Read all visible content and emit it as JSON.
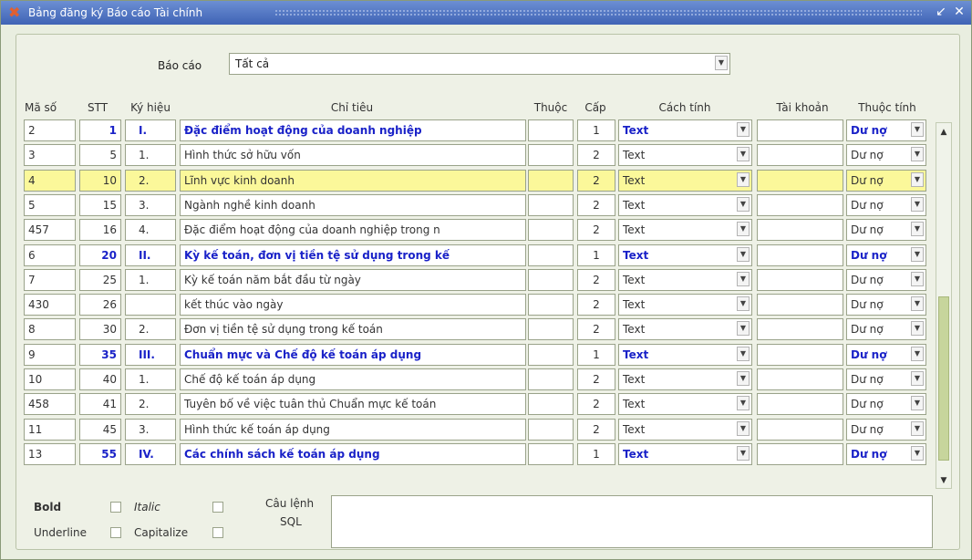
{
  "window": {
    "title": "Bảng đăng ký Báo cáo Tài chính"
  },
  "filter": {
    "label": "Báo cáo",
    "value": "Tất cả"
  },
  "columns": {
    "ma_so": "Mã số",
    "stt": "STT",
    "ky_hieu": "Ký hiệu",
    "chi_tieu": "Chỉ tiêu",
    "thuoc": "Thuộc",
    "cap": "Cấp",
    "cach_tinh": "Cách tính",
    "tai_khoan": "Tài khoản",
    "thuoc_tinh": "Thuộc tính"
  },
  "rows": [
    {
      "ma_so": "2",
      "stt": "1",
      "ky_hieu": "I.",
      "chi_tieu": "Đặc điểm hoạt động của doanh nghiệp",
      "thuoc": "",
      "cap": "1",
      "cach_tinh": "Text",
      "tai_khoan": "",
      "thuoc_tinh": "Dư nợ",
      "bold": true
    },
    {
      "ma_so": "3",
      "stt": "5",
      "ky_hieu": "1.",
      "chi_tieu": "Hình thức sở hữu vốn",
      "thuoc": "",
      "cap": "2",
      "cach_tinh": "Text",
      "tai_khoan": "",
      "thuoc_tinh": "Dư nợ",
      "bold": false
    },
    {
      "ma_so": "4",
      "stt": "10",
      "ky_hieu": "2.",
      "chi_tieu": "Lĩnh vực kinh doanh",
      "thuoc": "",
      "cap": "2",
      "cach_tinh": "Text",
      "tai_khoan": "",
      "thuoc_tinh": "Dư nợ",
      "bold": false,
      "selected": true
    },
    {
      "ma_so": "5",
      "stt": "15",
      "ky_hieu": "3.",
      "chi_tieu": "Ngành nghề kinh doanh",
      "thuoc": "",
      "cap": "2",
      "cach_tinh": "Text",
      "tai_khoan": "",
      "thuoc_tinh": "Dư nợ",
      "bold": false
    },
    {
      "ma_so": "457",
      "stt": "16",
      "ky_hieu": "4.",
      "chi_tieu": "Đặc điểm hoạt động của doanh nghiệp trong n",
      "thuoc": "",
      "cap": "2",
      "cach_tinh": "Text",
      "tai_khoan": "",
      "thuoc_tinh": "Dư nợ",
      "bold": false
    },
    {
      "ma_so": "6",
      "stt": "20",
      "ky_hieu": "II.",
      "chi_tieu": "Kỳ kế toán, đơn vị tiền tệ sử dụng trong kế",
      "thuoc": "",
      "cap": "1",
      "cach_tinh": "Text",
      "tai_khoan": "",
      "thuoc_tinh": "Dư nợ",
      "bold": true
    },
    {
      "ma_so": "7",
      "stt": "25",
      "ky_hieu": "1.",
      "chi_tieu": "Kỳ kế toán năm bắt đầu từ ngày",
      "thuoc": "",
      "cap": "2",
      "cach_tinh": "Text",
      "tai_khoan": "",
      "thuoc_tinh": "Dư nợ",
      "bold": false
    },
    {
      "ma_so": "430",
      "stt": "26",
      "ky_hieu": "",
      "chi_tieu": "kết thúc vào ngày",
      "thuoc": "",
      "cap": "2",
      "cach_tinh": "Text",
      "tai_khoan": "",
      "thuoc_tinh": "Dư nợ",
      "bold": false
    },
    {
      "ma_so": "8",
      "stt": "30",
      "ky_hieu": "2.",
      "chi_tieu": "Đơn vị tiền tệ sử dụng trong kế toán",
      "thuoc": "",
      "cap": "2",
      "cach_tinh": "Text",
      "tai_khoan": "",
      "thuoc_tinh": "Dư nợ",
      "bold": false
    },
    {
      "ma_so": "9",
      "stt": "35",
      "ky_hieu": "III.",
      "chi_tieu": "Chuẩn mực và Chế độ kế toán áp dụng",
      "thuoc": "",
      "cap": "1",
      "cach_tinh": "Text",
      "tai_khoan": "",
      "thuoc_tinh": "Dư nợ",
      "bold": true
    },
    {
      "ma_so": "10",
      "stt": "40",
      "ky_hieu": "1.",
      "chi_tieu": "Chế độ kế toán áp dụng",
      "thuoc": "",
      "cap": "2",
      "cach_tinh": "Text",
      "tai_khoan": "",
      "thuoc_tinh": "Dư nợ",
      "bold": false
    },
    {
      "ma_so": "458",
      "stt": "41",
      "ky_hieu": "2.",
      "chi_tieu": "Tuyên bố về việc tuân thủ Chuẩn mực kế toán",
      "thuoc": "",
      "cap": "2",
      "cach_tinh": "Text",
      "tai_khoan": "",
      "thuoc_tinh": "Dư nợ",
      "bold": false
    },
    {
      "ma_so": "11",
      "stt": "45",
      "ky_hieu": "3.",
      "chi_tieu": "Hình thức kế toán áp dụng",
      "thuoc": "",
      "cap": "2",
      "cach_tinh": "Text",
      "tai_khoan": "",
      "thuoc_tinh": "Dư nợ",
      "bold": false
    },
    {
      "ma_so": "13",
      "stt": "55",
      "ky_hieu": "IV.",
      "chi_tieu": "Các chính sách kế toán áp dụng",
      "thuoc": "",
      "cap": "1",
      "cach_tinh": "Text",
      "tai_khoan": "",
      "thuoc_tinh": "Dư nợ",
      "bold": true
    }
  ],
  "footer": {
    "bold_label": "Bold",
    "italic_label": "Italic",
    "underline_label": "Underline",
    "capitalize_label": "Capitalize",
    "sql_label_line1": "Câu lệnh",
    "sql_label_line2": "SQL",
    "sql_value": ""
  },
  "icons": {
    "app": "app-logo-icon",
    "minimize": "pin-icon",
    "close": "close-icon",
    "dropdown": "chevron-down-icon",
    "scroll_up": "arrow-up-icon",
    "scroll_down": "arrow-down-icon"
  },
  "colors": {
    "highlight": "#fbf89a",
    "bold_text": "#1a22c8",
    "titlebar": "#4a6ec0"
  }
}
